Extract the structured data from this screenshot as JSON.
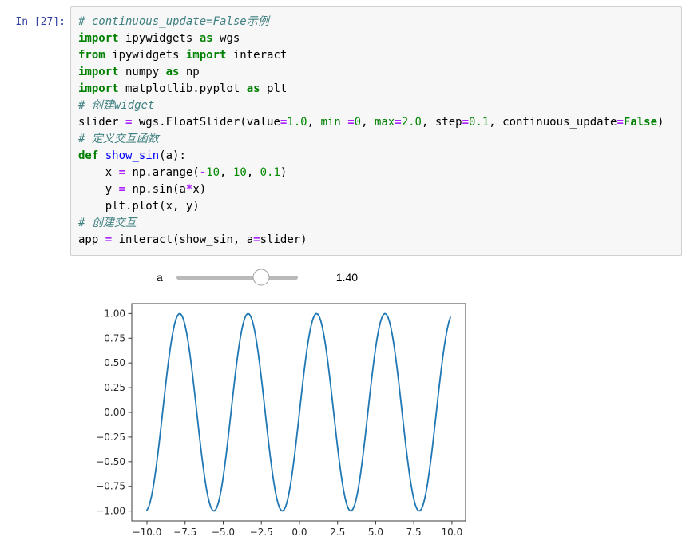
{
  "cell": {
    "prompt": "In [27]:",
    "prompt_color": "#303F9F",
    "background": "#f7f7f7",
    "border_color": "#cfcfcf",
    "code_lines": [
      [
        {
          "c": "c",
          "t": "# continuous_update=False示例"
        }
      ],
      [
        {
          "c": "k",
          "t": "import"
        },
        {
          "c": "p",
          "t": " ipywidgets "
        },
        {
          "c": "k",
          "t": "as"
        },
        {
          "c": "p",
          "t": " wgs"
        }
      ],
      [
        {
          "c": "k",
          "t": "from"
        },
        {
          "c": "p",
          "t": " ipywidgets "
        },
        {
          "c": "k",
          "t": "import"
        },
        {
          "c": "p",
          "t": " interact"
        }
      ],
      [
        {
          "c": "k",
          "t": "import"
        },
        {
          "c": "p",
          "t": " numpy "
        },
        {
          "c": "k",
          "t": "as"
        },
        {
          "c": "p",
          "t": " np"
        }
      ],
      [
        {
          "c": "k",
          "t": "import"
        },
        {
          "c": "p",
          "t": " matplotlib.pyplot "
        },
        {
          "c": "k",
          "t": "as"
        },
        {
          "c": "p",
          "t": " plt"
        }
      ],
      [
        {
          "c": "c",
          "t": "# 创建widget"
        }
      ],
      [
        {
          "c": "p",
          "t": "slider "
        },
        {
          "c": "o",
          "t": "="
        },
        {
          "c": "p",
          "t": " wgs.FloatSlider(value"
        },
        {
          "c": "o",
          "t": "="
        },
        {
          "c": "n",
          "t": "1.0"
        },
        {
          "c": "p",
          "t": ", "
        },
        {
          "c": "b",
          "t": "min"
        },
        {
          "c": "p",
          "t": " "
        },
        {
          "c": "o",
          "t": "="
        },
        {
          "c": "n",
          "t": "0"
        },
        {
          "c": "p",
          "t": ", "
        },
        {
          "c": "b",
          "t": "max"
        },
        {
          "c": "o",
          "t": "="
        },
        {
          "c": "n",
          "t": "2.0"
        },
        {
          "c": "p",
          "t": ", step"
        },
        {
          "c": "o",
          "t": "="
        },
        {
          "c": "n",
          "t": "0.1"
        },
        {
          "c": "p",
          "t": ", continuous_update"
        },
        {
          "c": "o",
          "t": "="
        },
        {
          "c": "k",
          "t": "False"
        },
        {
          "c": "p",
          "t": ")"
        }
      ],
      [
        {
          "c": "c",
          "t": "# 定义交互函数"
        }
      ],
      [
        {
          "c": "k",
          "t": "def"
        },
        {
          "c": "p",
          "t": " "
        },
        {
          "c": "f",
          "t": "show_sin"
        },
        {
          "c": "p",
          "t": "(a):"
        }
      ],
      [
        {
          "c": "p",
          "t": "    x "
        },
        {
          "c": "o",
          "t": "="
        },
        {
          "c": "p",
          "t": " np.arange("
        },
        {
          "c": "o",
          "t": "-"
        },
        {
          "c": "n",
          "t": "10"
        },
        {
          "c": "p",
          "t": ", "
        },
        {
          "c": "n",
          "t": "10"
        },
        {
          "c": "p",
          "t": ", "
        },
        {
          "c": "n",
          "t": "0.1"
        },
        {
          "c": "p",
          "t": ")"
        }
      ],
      [
        {
          "c": "p",
          "t": "    y "
        },
        {
          "c": "o",
          "t": "="
        },
        {
          "c": "p",
          "t": " np.sin(a"
        },
        {
          "c": "o",
          "t": "*"
        },
        {
          "c": "p",
          "t": "x)"
        }
      ],
      [
        {
          "c": "p",
          "t": "    plt.plot(x, y)"
        }
      ],
      [
        {
          "c": "c",
          "t": "# 创建交互"
        }
      ],
      [
        {
          "c": "p",
          "t": "app "
        },
        {
          "c": "o",
          "t": "="
        },
        {
          "c": "p",
          "t": " interact(show_sin, a"
        },
        {
          "c": "o",
          "t": "="
        },
        {
          "c": "p",
          "t": "slider)"
        }
      ]
    ]
  },
  "widget": {
    "label": "a",
    "readout": "1.40",
    "value": 1.4,
    "min": 0,
    "max": 2.0,
    "step": 0.1,
    "track_color": "#b9b9b9",
    "handle_fill": "#ffffff",
    "handle_border": "#a0a0a0"
  },
  "chart_data": {
    "type": "line",
    "title": "",
    "xlabel": "",
    "ylabel": "",
    "expression": "y = sin(a*x)",
    "a": 1.4,
    "x_start": -10,
    "x_end": 9.9,
    "x_step": 0.1,
    "xlim": [
      -10.995,
      10.895
    ],
    "ylim": [
      -1.1,
      1.1
    ],
    "xticks": [
      -10,
      -7.5,
      -5,
      -2.5,
      0,
      2.5,
      5,
      7.5,
      10
    ],
    "xtick_labels": [
      "−10.0",
      "−7.5",
      "−5.0",
      "−2.5",
      "0.0",
      "2.5",
      "5.0",
      "7.5",
      "10.0"
    ],
    "yticks": [
      1,
      0.75,
      0.5,
      0.25,
      0,
      -0.25,
      -0.5,
      -0.75,
      -1
    ],
    "ytick_labels": [
      "1.00",
      "0.75",
      "0.50",
      "0.25",
      "0.00",
      "−0.25",
      "−0.50",
      "−0.75",
      "−1.00"
    ],
    "line_color": "#1f77b4",
    "spine_color": "#3b3b3b",
    "grid": false,
    "legend_position": "none"
  }
}
